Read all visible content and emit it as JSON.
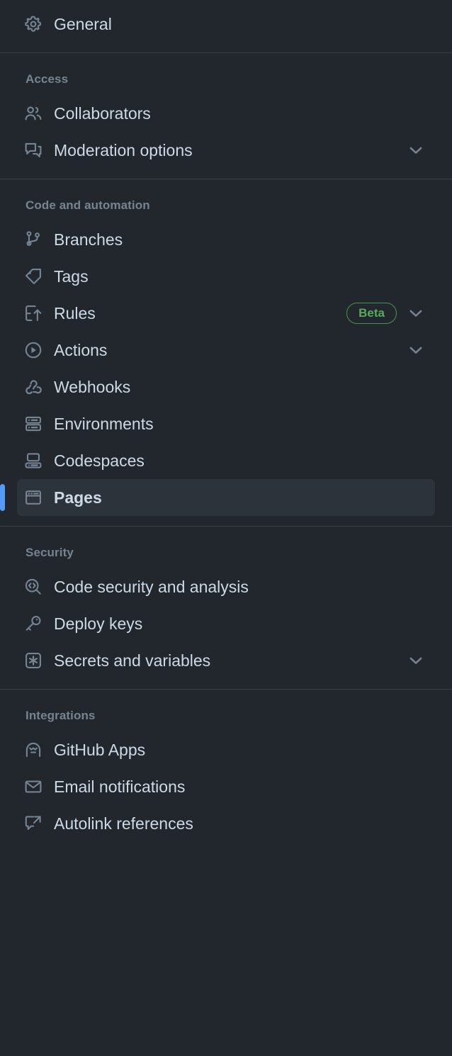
{
  "sidebar": {
    "accent_selected": "#539bf5",
    "background": "#22272e",
    "selected_background": "#2d333b",
    "divider_color": "#373e47",
    "text_color": "#cdd9e5",
    "muted_color": "#768390",
    "badge_color": "#57ab5a",
    "groups": [
      {
        "heading": null,
        "items": [
          {
            "label": "General",
            "icon": "gear-icon",
            "selected": false,
            "badge": null,
            "chevron": false
          }
        ]
      },
      {
        "heading": "Access",
        "items": [
          {
            "label": "Collaborators",
            "icon": "people-icon",
            "selected": false,
            "badge": null,
            "chevron": false
          },
          {
            "label": "Moderation options",
            "icon": "comment-discussion-icon",
            "selected": false,
            "badge": null,
            "chevron": true
          }
        ]
      },
      {
        "heading": "Code and automation",
        "items": [
          {
            "label": "Branches",
            "icon": "git-branch-icon",
            "selected": false,
            "badge": null,
            "chevron": false
          },
          {
            "label": "Tags",
            "icon": "tag-icon",
            "selected": false,
            "badge": null,
            "chevron": false
          },
          {
            "label": "Rules",
            "icon": "rules-icon",
            "selected": false,
            "badge": "Beta",
            "chevron": true
          },
          {
            "label": "Actions",
            "icon": "play-circle-icon",
            "selected": false,
            "badge": null,
            "chevron": true
          },
          {
            "label": "Webhooks",
            "icon": "webhook-icon",
            "selected": false,
            "badge": null,
            "chevron": false
          },
          {
            "label": "Environments",
            "icon": "server-icon",
            "selected": false,
            "badge": null,
            "chevron": false
          },
          {
            "label": "Codespaces",
            "icon": "codespaces-icon",
            "selected": false,
            "badge": null,
            "chevron": false
          },
          {
            "label": "Pages",
            "icon": "browser-window-icon",
            "selected": true,
            "badge": null,
            "chevron": false
          }
        ]
      },
      {
        "heading": "Security",
        "items": [
          {
            "label": "Code security and analysis",
            "icon": "code-search-icon",
            "selected": false,
            "badge": null,
            "chevron": false
          },
          {
            "label": "Deploy keys",
            "icon": "key-icon",
            "selected": false,
            "badge": null,
            "chevron": false
          },
          {
            "label": "Secrets and variables",
            "icon": "asterisk-box-icon",
            "selected": false,
            "badge": null,
            "chevron": true
          }
        ]
      },
      {
        "heading": "Integrations",
        "items": [
          {
            "label": "GitHub Apps",
            "icon": "robot-icon",
            "selected": false,
            "badge": null,
            "chevron": false
          },
          {
            "label": "Email notifications",
            "icon": "mail-icon",
            "selected": false,
            "badge": null,
            "chevron": false
          },
          {
            "label": "Autolink references",
            "icon": "cross-reference-icon",
            "selected": false,
            "badge": null,
            "chevron": false
          }
        ]
      }
    ]
  }
}
